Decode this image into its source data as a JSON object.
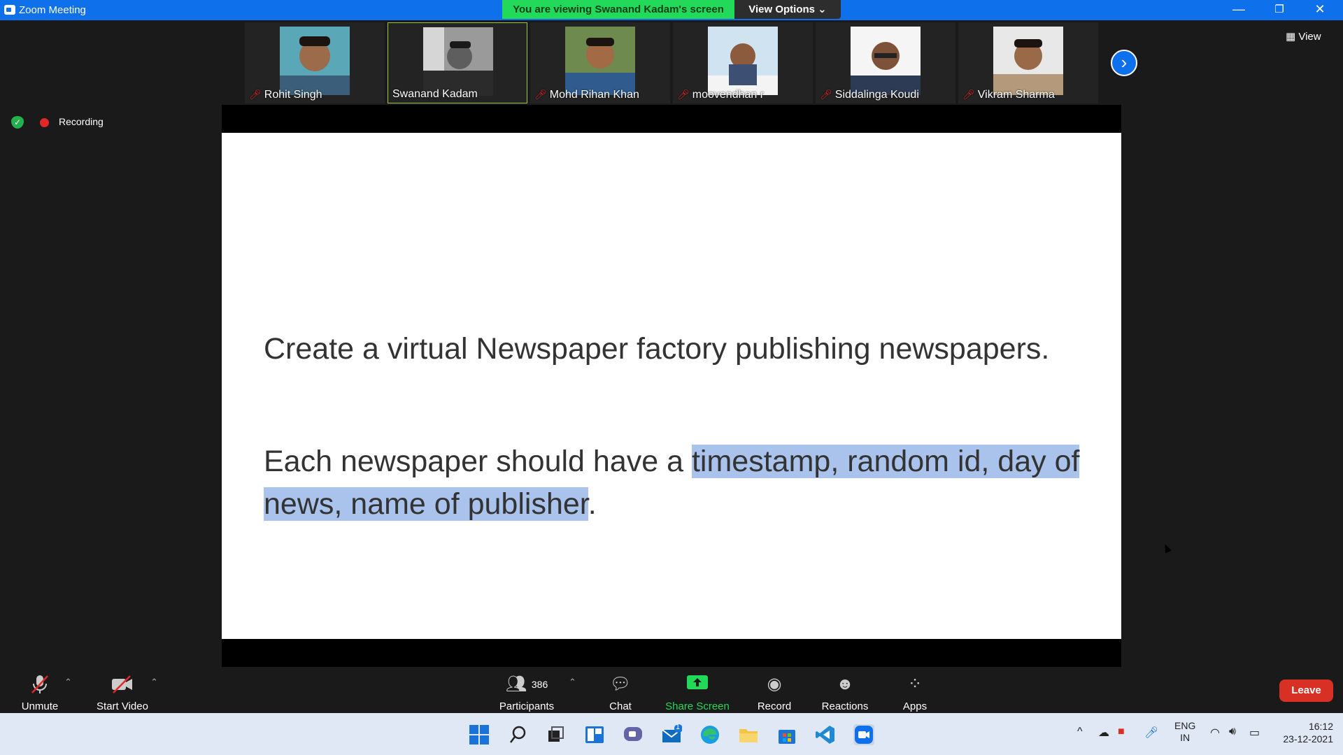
{
  "window": {
    "title": "Zoom Meeting",
    "viewing_banner": "You are viewing Swanand Kadam's screen",
    "view_options": "View Options ⌄",
    "minimize": "—",
    "restore": "❐",
    "close": "✕"
  },
  "participants_strip": [
    {
      "name": "Rohit Singh",
      "muted": true,
      "active": false
    },
    {
      "name": "Swanand Kadam",
      "muted": false,
      "active": true
    },
    {
      "name": "Mohd Rihan Khan",
      "muted": true,
      "active": false
    },
    {
      "name": "moovendhan r",
      "muted": true,
      "active": false
    },
    {
      "name": "Siddalinga Koudi",
      "muted": true,
      "active": false
    },
    {
      "name": "Vikram Sharma",
      "muted": true,
      "active": false
    }
  ],
  "next_arrow": "›",
  "view_button": "View",
  "recording": {
    "label": "Recording"
  },
  "slide": {
    "line1": "Create a virtual Newspaper factory publishing newspapers.",
    "line2_pre": "Each newspaper should have a ",
    "line2_highlight": "timestamp, random id, day of news, name of publisher",
    "line2_post": "."
  },
  "toolbar": {
    "unmute": "Unmute",
    "start_video": "Start Video",
    "participants": "Participants",
    "participant_count": "386",
    "chat": "Chat",
    "share_screen": "Share Screen",
    "record": "Record",
    "reactions": "Reactions",
    "apps": "Apps",
    "leave": "Leave"
  },
  "taskbar": {
    "language_top": "ENG",
    "language_bottom": "IN",
    "time": "16:12",
    "date": "23-12-2021",
    "mail_badge": "1"
  }
}
